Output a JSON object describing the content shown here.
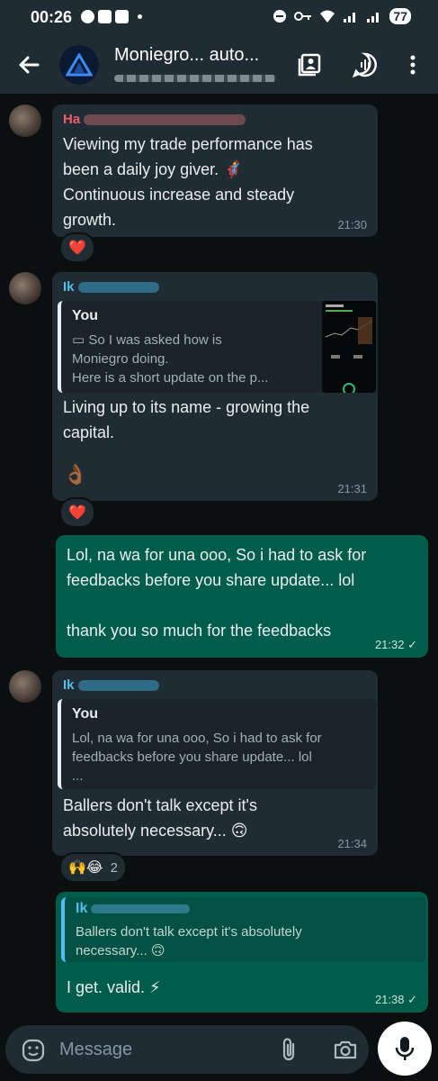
{
  "status": {
    "time": "00:26",
    "battery": "77"
  },
  "header": {
    "title": "Moniegro... auto...",
    "subtitle": ""
  },
  "messages": [
    {
      "sender": "Ha",
      "lines": [
        "Viewing my trade performance has",
        "been a daily joy giver. 🦸",
        "Continuous increase and steady",
        "growth."
      ],
      "time": "21:30",
      "reaction": "❤️"
    },
    {
      "sender": "Ik",
      "quote_author": "You",
      "quote_lines": [
        "So I was asked how is",
        "Moniegro doing.",
        "Here is a short update on the p..."
      ],
      "lines": [
        "Living up to its name - growing the",
        "capital."
      ],
      "emoji": "👌🏾",
      "time": "21:31",
      "reaction": "❤️"
    },
    {
      "lines": [
        "Lol, na wa for una ooo, So i had to ask for",
        "feedbacks before you  share update... lol",
        "",
        "thank you so much for the feedbacks"
      ],
      "time": "21:32 ✓"
    },
    {
      "sender": "Ik",
      "quote_author": "You",
      "quote_lines": [
        "Lol, na wa for una ooo, So i had to ask for",
        "feedbacks before you  share update... lol",
        "..."
      ],
      "lines": [
        "Ballers don't talk except it's",
        "absolutely necessary... 🙃"
      ],
      "time": "21:34",
      "reaction": "🙌😂",
      "reaction_count": "2"
    },
    {
      "quote_author": "Ik",
      "quote_lines": [
        "Ballers don't talk except it's absolutely",
        "necessary... 🙃"
      ],
      "lines": [
        "I get. valid. ⚡"
      ],
      "time": "21:38 ✓"
    }
  ],
  "input": {
    "placeholder": "Message"
  },
  "colors": {
    "bg": "#0b0f10",
    "incoming": "#202c33",
    "outgoing": "#005c4b",
    "header": "#1f2c33"
  }
}
